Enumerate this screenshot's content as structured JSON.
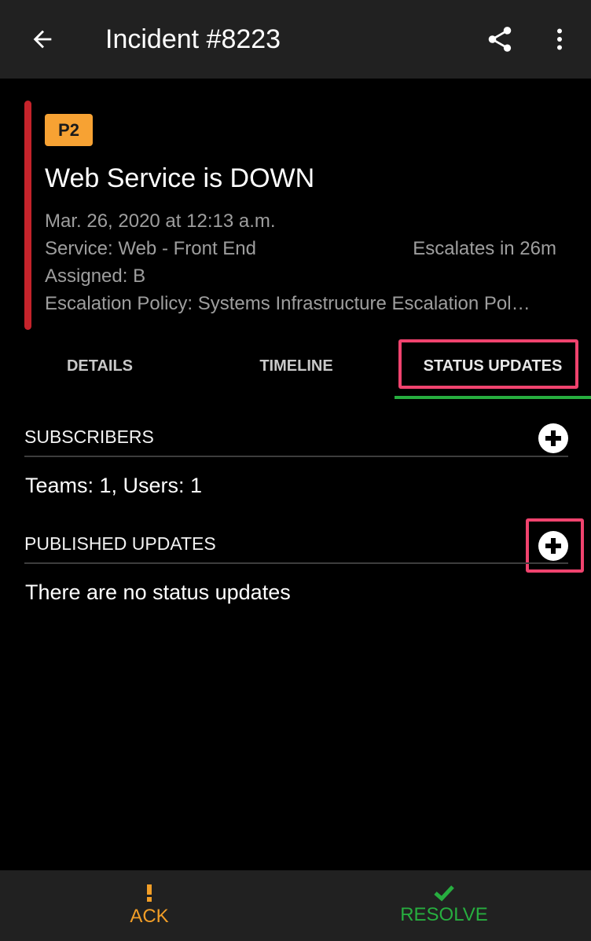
{
  "app_bar": {
    "title": "Incident #8223",
    "back_icon": "arrow-left-icon",
    "share_icon": "share-icon",
    "more_icon": "more-vertical-icon"
  },
  "incident": {
    "priority": "P2",
    "title": "Web Service is DOWN",
    "date": "Mar. 26, 2020 at 12:13 a.m.",
    "service": "Service: Web - Front End",
    "escalates": "Escalates in 26m",
    "assigned": "Assigned: B",
    "escalation_policy": "Escalation Policy: Systems Infrastructure Escalation Pol…",
    "colors": {
      "stripe": "#c5232b",
      "priority_badge": "#f7a233"
    }
  },
  "tabs": [
    {
      "label": "DETAILS",
      "active": false
    },
    {
      "label": "TIMELINE",
      "active": false
    },
    {
      "label": "STATUS UPDATES",
      "active": true
    }
  ],
  "subscribers": {
    "title": "SUBSCRIBERS",
    "summary": "Teams: 1, Users: 1",
    "add_icon": "plus-circle-icon"
  },
  "published_updates": {
    "title": "PUBLISHED UPDATES",
    "empty_text": "There are no status updates",
    "add_icon": "plus-circle-icon"
  },
  "bottom_bar": {
    "ack": {
      "label": "ACK",
      "icon": "exclamation-icon",
      "color": "#f29e27"
    },
    "resolve": {
      "label": "RESOLVE",
      "icon": "checkmark-icon",
      "color": "#27ae3f"
    }
  },
  "colors": {
    "highlight": "#f0436e",
    "active_tab_underline": "#27ae3f",
    "app_bar": "#212121"
  }
}
